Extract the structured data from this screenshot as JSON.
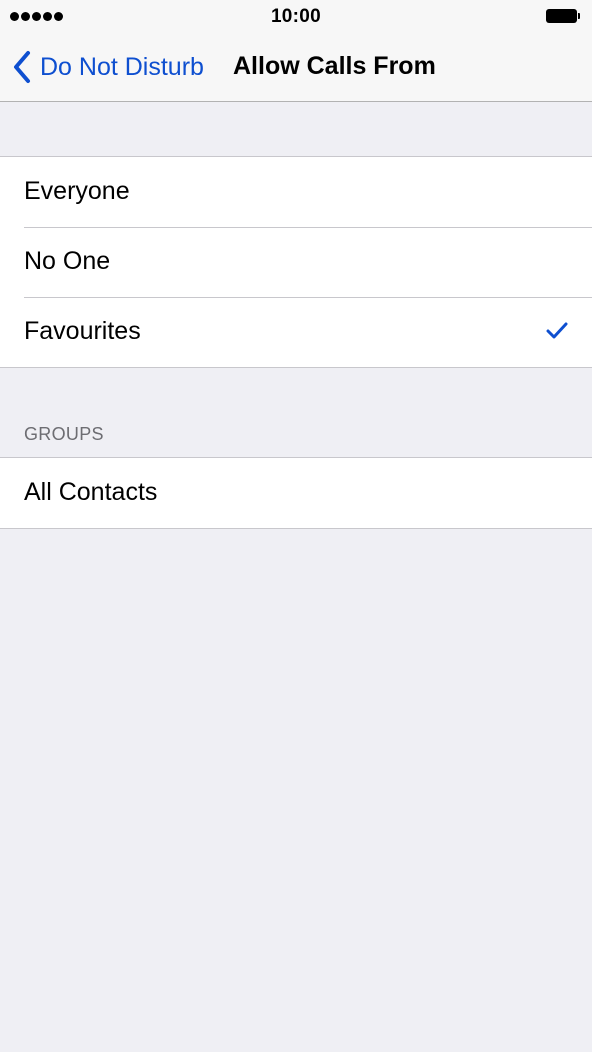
{
  "status_bar": {
    "time": "10:00",
    "signal_icon": "signal-dots-icon",
    "battery_icon": "battery-icon"
  },
  "nav": {
    "back_label": "Do Not Disturb",
    "back_icon": "chevron-left-icon",
    "title": "Allow Calls From"
  },
  "options": {
    "items": [
      {
        "label": "Everyone",
        "selected": false
      },
      {
        "label": "No One",
        "selected": false
      },
      {
        "label": "Favourites",
        "selected": true
      }
    ],
    "check_icon": "checkmark-icon"
  },
  "groups": {
    "header": "GROUPS",
    "items": [
      {
        "label": "All Contacts"
      }
    ]
  },
  "colors": {
    "accent": "#0e4fd0",
    "background": "#efeff4",
    "separator": "#c8c7cc",
    "section_header": "#6d6d72"
  }
}
